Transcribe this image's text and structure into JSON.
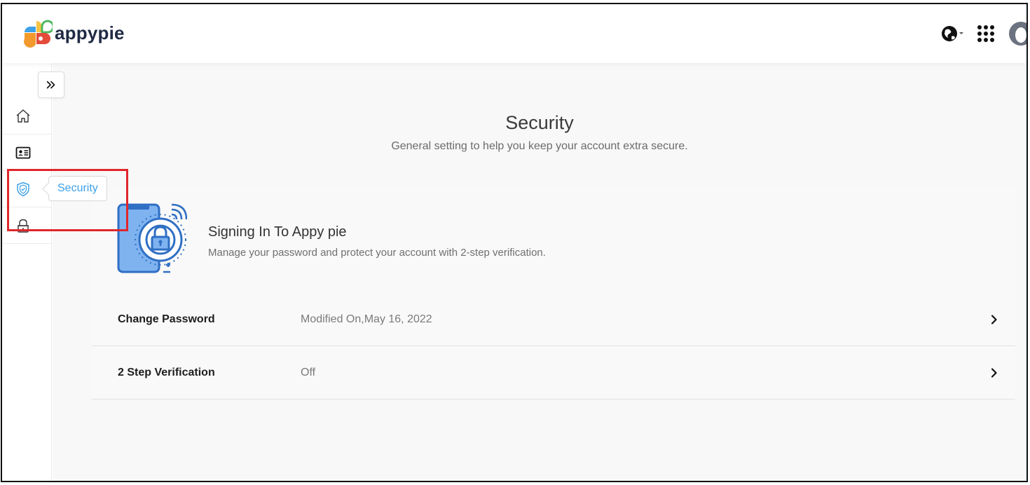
{
  "app": {
    "logo_text": "appypie",
    "brand_colors": {
      "blue": "#3ea2e8",
      "orange": "#f29a2e",
      "red": "#e54b3a",
      "green": "#4fb860",
      "yellow": "#f6c343"
    }
  },
  "header": {
    "icons": [
      "globe-icon",
      "apps-grid-icon",
      "user-avatar"
    ]
  },
  "sidebar": {
    "expand_icon": "double-chevron-right-icon",
    "items": [
      {
        "id": "home",
        "icon": "home-icon"
      },
      {
        "id": "profile",
        "icon": "id-card-icon"
      },
      {
        "id": "security",
        "icon": "shield-icon",
        "active": true
      },
      {
        "id": "privacy",
        "icon": "lock-icon"
      }
    ],
    "tooltip": "Security"
  },
  "main": {
    "title": "Security",
    "subtitle": "General setting to help you keep your account extra secure.",
    "card": {
      "title": "Signing In To Appy pie",
      "description": "Manage your password and protect your account with 2-step verification.",
      "rows": [
        {
          "label": "Change Password",
          "value": "Modified On,May 16, 2022"
        },
        {
          "label": "2 Step Verification",
          "value": "Off"
        }
      ]
    }
  },
  "annotation": {
    "highlight_color": "#e0262b"
  }
}
